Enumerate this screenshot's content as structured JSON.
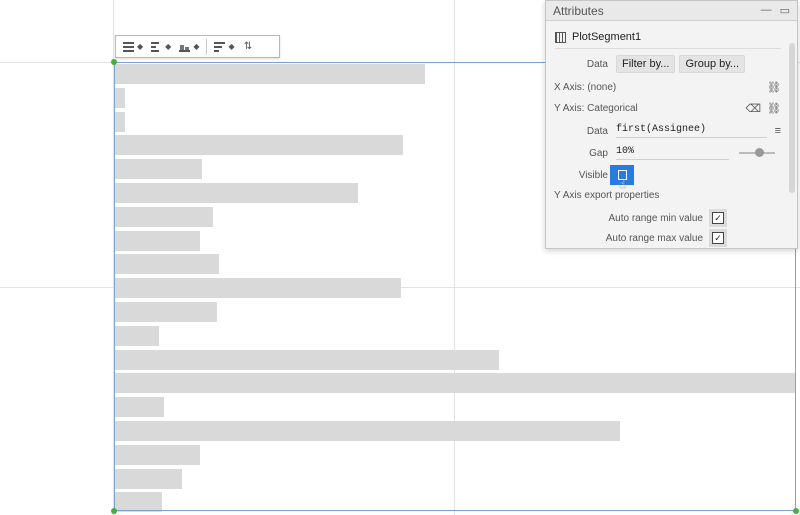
{
  "toolbar": {
    "buttons": [
      {
        "name": "align-rows-icon"
      },
      {
        "name": "align-left-icon"
      },
      {
        "name": "align-bottom-icon"
      },
      {
        "name": "sort-icon"
      },
      {
        "name": "swap-icon"
      }
    ],
    "caret": "◆"
  },
  "chart_data": {
    "type": "bar",
    "orientation": "horizontal",
    "bar_color": "#d9d9d9",
    "categories": [
      "",
      "",
      "",
      "",
      "",
      "",
      "",
      "",
      "",
      "",
      "",
      "",
      "",
      "",
      "",
      "",
      "",
      "",
      "",
      ""
    ],
    "values": [
      310,
      10,
      10,
      288,
      87,
      243,
      98,
      85,
      104,
      286,
      102,
      44,
      384,
      680,
      49,
      505,
      85,
      67,
      47,
      0
    ],
    "xlim": [
      0,
      680
    ]
  },
  "panel": {
    "title": "Attributes",
    "object_name": "PlotSegment1",
    "data_label": "Data",
    "filter_button": "Filter by...",
    "group_button": "Group by...",
    "x_axis_label": "X Axis: (none)",
    "y_axis_label": "Y Axis: Categorical",
    "y_data_label": "Data",
    "y_data_value": "first(Assignee)",
    "gap_label": "Gap",
    "gap_value": "10%",
    "visible_label": "Visible",
    "export_label": "Y Axis export properties",
    "auto_min_label": "Auto range min value",
    "auto_max_label": "Auto range max value",
    "check_glyph": "✓",
    "minimize_glyph": "—",
    "restore_glyph": "▭",
    "gap_fraction": 0.58
  }
}
